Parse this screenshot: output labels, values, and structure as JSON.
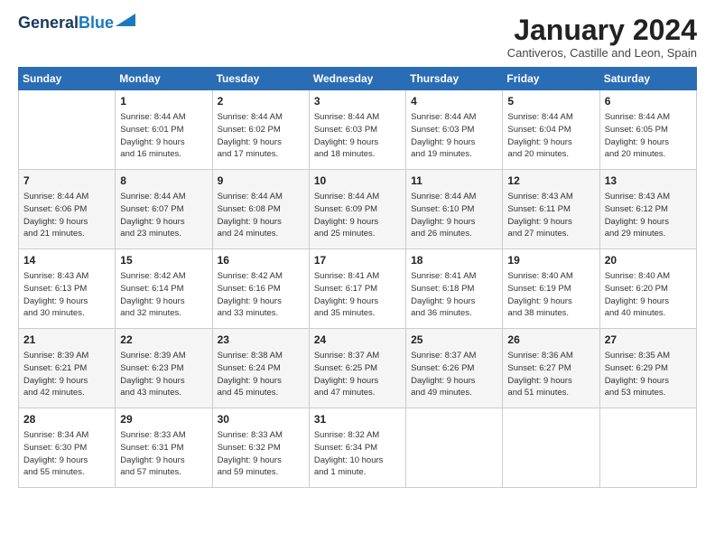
{
  "logo": {
    "line1": "General",
    "line2": "Blue"
  },
  "title": "January 2024",
  "subtitle": "Cantiveros, Castille and Leon, Spain",
  "days_of_week": [
    "Sunday",
    "Monday",
    "Tuesday",
    "Wednesday",
    "Thursday",
    "Friday",
    "Saturday"
  ],
  "weeks": [
    [
      {
        "num": "",
        "info": ""
      },
      {
        "num": "1",
        "info": "Sunrise: 8:44 AM\nSunset: 6:01 PM\nDaylight: 9 hours\nand 16 minutes."
      },
      {
        "num": "2",
        "info": "Sunrise: 8:44 AM\nSunset: 6:02 PM\nDaylight: 9 hours\nand 17 minutes."
      },
      {
        "num": "3",
        "info": "Sunrise: 8:44 AM\nSunset: 6:03 PM\nDaylight: 9 hours\nand 18 minutes."
      },
      {
        "num": "4",
        "info": "Sunrise: 8:44 AM\nSunset: 6:03 PM\nDaylight: 9 hours\nand 19 minutes."
      },
      {
        "num": "5",
        "info": "Sunrise: 8:44 AM\nSunset: 6:04 PM\nDaylight: 9 hours\nand 20 minutes."
      },
      {
        "num": "6",
        "info": "Sunrise: 8:44 AM\nSunset: 6:05 PM\nDaylight: 9 hours\nand 20 minutes."
      }
    ],
    [
      {
        "num": "7",
        "info": "Sunrise: 8:44 AM\nSunset: 6:06 PM\nDaylight: 9 hours\nand 21 minutes."
      },
      {
        "num": "8",
        "info": "Sunrise: 8:44 AM\nSunset: 6:07 PM\nDaylight: 9 hours\nand 23 minutes."
      },
      {
        "num": "9",
        "info": "Sunrise: 8:44 AM\nSunset: 6:08 PM\nDaylight: 9 hours\nand 24 minutes."
      },
      {
        "num": "10",
        "info": "Sunrise: 8:44 AM\nSunset: 6:09 PM\nDaylight: 9 hours\nand 25 minutes."
      },
      {
        "num": "11",
        "info": "Sunrise: 8:44 AM\nSunset: 6:10 PM\nDaylight: 9 hours\nand 26 minutes."
      },
      {
        "num": "12",
        "info": "Sunrise: 8:43 AM\nSunset: 6:11 PM\nDaylight: 9 hours\nand 27 minutes."
      },
      {
        "num": "13",
        "info": "Sunrise: 8:43 AM\nSunset: 6:12 PM\nDaylight: 9 hours\nand 29 minutes."
      }
    ],
    [
      {
        "num": "14",
        "info": "Sunrise: 8:43 AM\nSunset: 6:13 PM\nDaylight: 9 hours\nand 30 minutes."
      },
      {
        "num": "15",
        "info": "Sunrise: 8:42 AM\nSunset: 6:14 PM\nDaylight: 9 hours\nand 32 minutes."
      },
      {
        "num": "16",
        "info": "Sunrise: 8:42 AM\nSunset: 6:16 PM\nDaylight: 9 hours\nand 33 minutes."
      },
      {
        "num": "17",
        "info": "Sunrise: 8:41 AM\nSunset: 6:17 PM\nDaylight: 9 hours\nand 35 minutes."
      },
      {
        "num": "18",
        "info": "Sunrise: 8:41 AM\nSunset: 6:18 PM\nDaylight: 9 hours\nand 36 minutes."
      },
      {
        "num": "19",
        "info": "Sunrise: 8:40 AM\nSunset: 6:19 PM\nDaylight: 9 hours\nand 38 minutes."
      },
      {
        "num": "20",
        "info": "Sunrise: 8:40 AM\nSunset: 6:20 PM\nDaylight: 9 hours\nand 40 minutes."
      }
    ],
    [
      {
        "num": "21",
        "info": "Sunrise: 8:39 AM\nSunset: 6:21 PM\nDaylight: 9 hours\nand 42 minutes."
      },
      {
        "num": "22",
        "info": "Sunrise: 8:39 AM\nSunset: 6:23 PM\nDaylight: 9 hours\nand 43 minutes."
      },
      {
        "num": "23",
        "info": "Sunrise: 8:38 AM\nSunset: 6:24 PM\nDaylight: 9 hours\nand 45 minutes."
      },
      {
        "num": "24",
        "info": "Sunrise: 8:37 AM\nSunset: 6:25 PM\nDaylight: 9 hours\nand 47 minutes."
      },
      {
        "num": "25",
        "info": "Sunrise: 8:37 AM\nSunset: 6:26 PM\nDaylight: 9 hours\nand 49 minutes."
      },
      {
        "num": "26",
        "info": "Sunrise: 8:36 AM\nSunset: 6:27 PM\nDaylight: 9 hours\nand 51 minutes."
      },
      {
        "num": "27",
        "info": "Sunrise: 8:35 AM\nSunset: 6:29 PM\nDaylight: 9 hours\nand 53 minutes."
      }
    ],
    [
      {
        "num": "28",
        "info": "Sunrise: 8:34 AM\nSunset: 6:30 PM\nDaylight: 9 hours\nand 55 minutes."
      },
      {
        "num": "29",
        "info": "Sunrise: 8:33 AM\nSunset: 6:31 PM\nDaylight: 9 hours\nand 57 minutes."
      },
      {
        "num": "30",
        "info": "Sunrise: 8:33 AM\nSunset: 6:32 PM\nDaylight: 9 hours\nand 59 minutes."
      },
      {
        "num": "31",
        "info": "Sunrise: 8:32 AM\nSunset: 6:34 PM\nDaylight: 10 hours\nand 1 minute."
      },
      {
        "num": "",
        "info": ""
      },
      {
        "num": "",
        "info": ""
      },
      {
        "num": "",
        "info": ""
      }
    ]
  ]
}
